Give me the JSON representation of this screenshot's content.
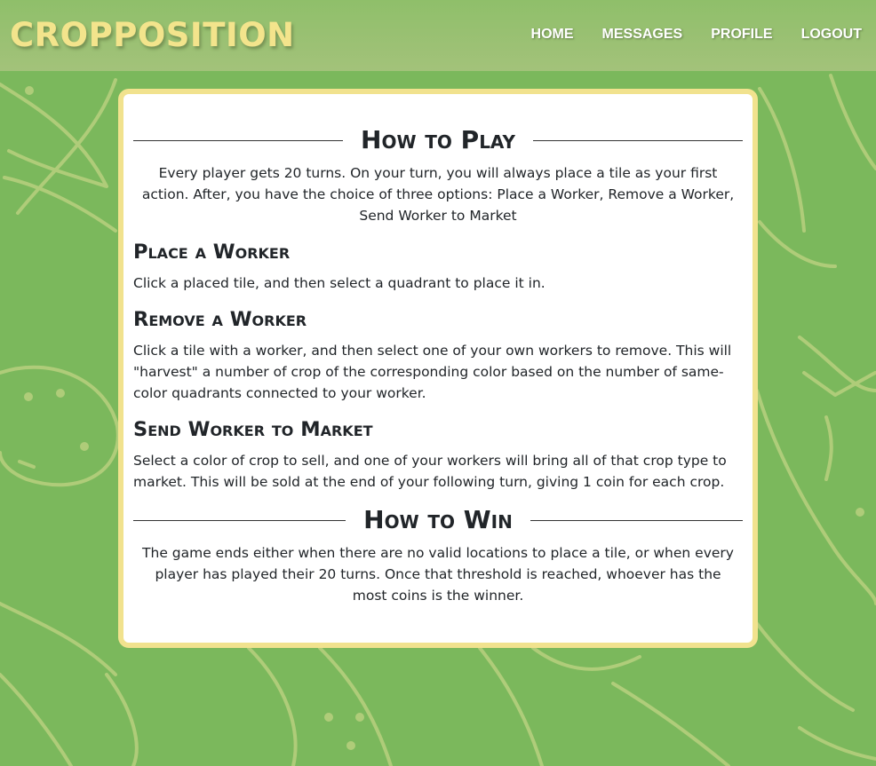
{
  "brand": {
    "title": "CROPPOSITION"
  },
  "nav": {
    "home": "HOME",
    "messages": "MESSAGES",
    "profile": "PROFILE",
    "logout": "LOGOUT"
  },
  "colors": {
    "background": "#7bb85c",
    "navbar": "#9fc178",
    "brand_text": "#f3e48c",
    "card_border": "#f1e28e",
    "card_background": "#ffffff",
    "doodle_stroke": "#b9d07f"
  },
  "how_to_play": {
    "title": "How to Play",
    "intro": "Every player gets 20 turns. On your turn, you will always place a tile as your first action. After, you have the choice of three options: Place a Worker, Remove a Worker, Send Worker to Market",
    "sections": [
      {
        "heading": "Place a Worker",
        "text": "Click a placed tile, and then select a quadrant to place it in."
      },
      {
        "heading": "Remove a Worker",
        "text": "Click a tile with a worker, and then select one of your own workers to remove. This will \"harvest\" a number of crop of the corresponding color based on the number of same-color quadrants connected to your worker."
      },
      {
        "heading": "Send Worker to Market",
        "text": "Select a color of crop to sell, and one of your workers will bring all of that crop type to market. This will be sold at the end of your following turn, giving 1 coin for each crop."
      }
    ]
  },
  "how_to_win": {
    "title": "How to Win",
    "text": "The game ends either when there are no valid locations to place a tile, or when every player has played their 20 turns. Once that threshold is reached, whoever has the most coins is the winner."
  }
}
